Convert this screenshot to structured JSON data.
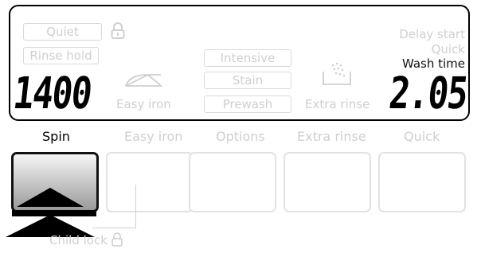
{
  "display": {
    "quiet": "Quiet",
    "rinse_hold": "Rinse hold",
    "spin_value": "1400",
    "easy_iron": "Easy iron",
    "options": [
      "Intensive",
      "Stain",
      "Prewash"
    ],
    "extra_rinse": "Extra rinse",
    "delay_start": "Delay start",
    "quick": "Quick",
    "wash_time_label": "Wash time",
    "wash_time_value": "2.05"
  },
  "buttons": {
    "spin": "Spin",
    "easy_iron": "Easy iron",
    "options": "Options",
    "extra_rinse": "Extra rinse",
    "quick": "Quick"
  },
  "child_lock": "Child lock",
  "colors": {
    "active": "#000000",
    "inactive": "#cfcfcf"
  }
}
